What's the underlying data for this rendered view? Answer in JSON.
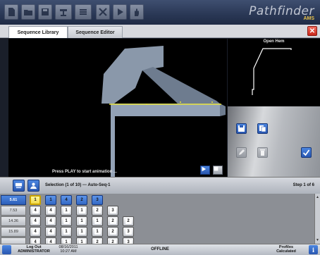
{
  "app": {
    "brand": "Pathfinder",
    "brand_sub": "AMS"
  },
  "toolbar": {
    "buttons": [
      "document-icon",
      "folder-icon",
      "save-icon",
      "machine-icon",
      "list-icon",
      "tools-icon",
      "play-icon",
      "hand-icon"
    ]
  },
  "tabs": [
    {
      "label": "Sequence Library",
      "active": true
    },
    {
      "label": "Sequence Editor",
      "active": false
    }
  ],
  "viewer": {
    "hint": "Press PLAY to start animation ..."
  },
  "part": {
    "name": "Open Hem"
  },
  "side_actions": {
    "buttons": [
      {
        "name": "save-sequence-icon",
        "enabled": true
      },
      {
        "name": "copy-sequence-icon",
        "enabled": true
      },
      {
        "name": "edit-icon",
        "enabled": false
      },
      {
        "name": "delete-icon",
        "enabled": false
      },
      {
        "name": "accept-check-icon",
        "enabled": true
      }
    ]
  },
  "selection": {
    "text": "Selection (1 of 10)  --- Auto-Seq-1",
    "step": "Step 1 of 6"
  },
  "sequences": [
    {
      "label": "5.61",
      "selected": true,
      "cells": [
        "1",
        "1",
        "4",
        "2",
        "3"
      ]
    },
    {
      "label": "7.53",
      "selected": false,
      "cells": [
        "4",
        "4",
        "1",
        "1",
        "2",
        "3"
      ]
    },
    {
      "label": "14.36",
      "selected": false,
      "cells": [
        "4",
        "4",
        "1",
        "1",
        "1",
        "2",
        "2"
      ]
    },
    {
      "label": "15.89",
      "selected": false,
      "cells": [
        "4",
        "4",
        "1",
        "1",
        "1",
        "2",
        "3"
      ]
    },
    {
      "label": "",
      "selected": false,
      "cells": [
        "4",
        "4",
        "1",
        "1",
        "2",
        "2",
        "3"
      ]
    }
  ],
  "status": {
    "logout_line1": "Log Out",
    "logout_line2": "ADMINISTRATOR",
    "date": "08/16/2011",
    "time": "10:27 AM",
    "connection": "OFFLINE",
    "profiles_line1": "Profiles",
    "profiles_line2": "Calculated",
    "info_label": "i"
  }
}
